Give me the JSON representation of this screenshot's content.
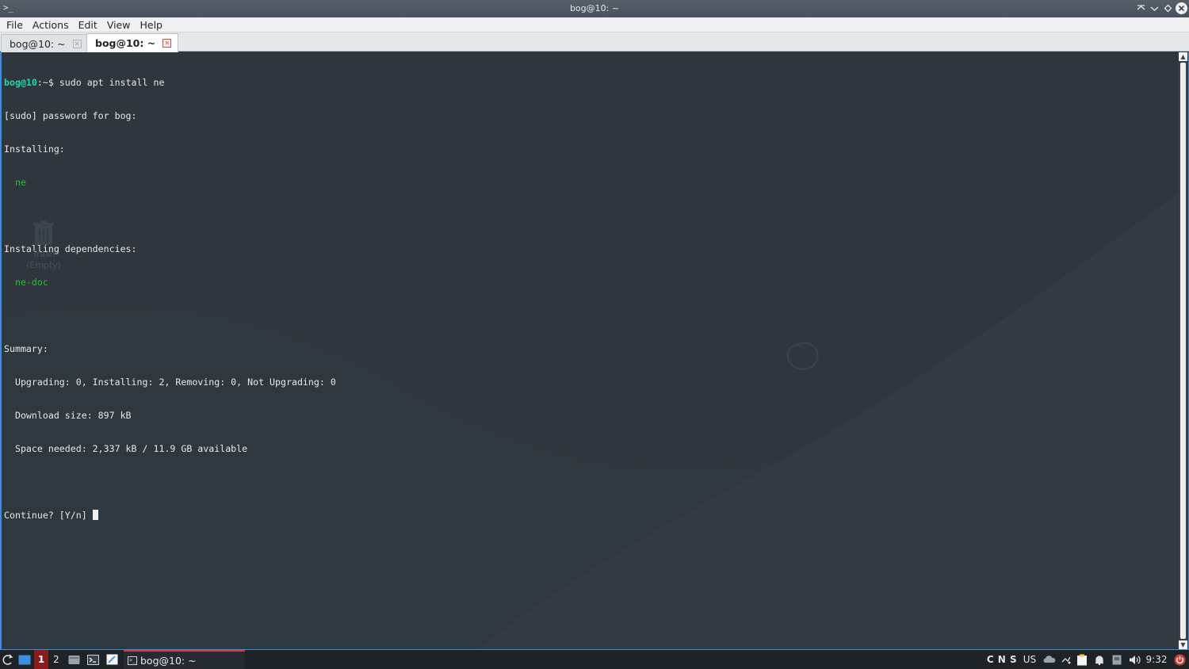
{
  "window": {
    "title": "bog@10: ~",
    "icon": ">_"
  },
  "menubar": {
    "items": [
      "File",
      "Actions",
      "Edit",
      "View",
      "Help"
    ]
  },
  "tabs": [
    {
      "label": "bog@10: ~",
      "active": false
    },
    {
      "label": "bog@10: ~",
      "active": true
    }
  ],
  "terminal": {
    "prompt_user": "bog@10",
    "prompt_rest": ":~$ ",
    "command": "sudo apt install ne",
    "lines": [
      "[sudo] password for bog:",
      "Installing:"
    ],
    "pkg1": "  ne",
    "dep_header": "Installing dependencies:",
    "pkg2": "  ne-doc",
    "summary_header": "Summary:",
    "summary_lines": [
      "  Upgrading: 0, Installing: 2, Removing: 0, Not Upgrading: 0",
      "  Download size: 897 kB",
      "  Space needed: 2,337 kB / 11.9 GB available"
    ],
    "continue_prompt": "Continue? [Y/n] "
  },
  "desktop": {
    "trash_label": "Trash",
    "trash_sub": "(Empty)"
  },
  "taskbar": {
    "workspace_1": "1",
    "workspace_2": "2",
    "task_label": "bog@10: ~",
    "tray_keys": "C N S",
    "keyboard_layout": "US",
    "clock": "9:32"
  },
  "colors": {
    "accent": "#3d8ee0",
    "prompt_user": "#1fd8a5",
    "package": "#27c22d",
    "terminal_bg": "#2f363d",
    "close_red": "#e04a3f"
  }
}
